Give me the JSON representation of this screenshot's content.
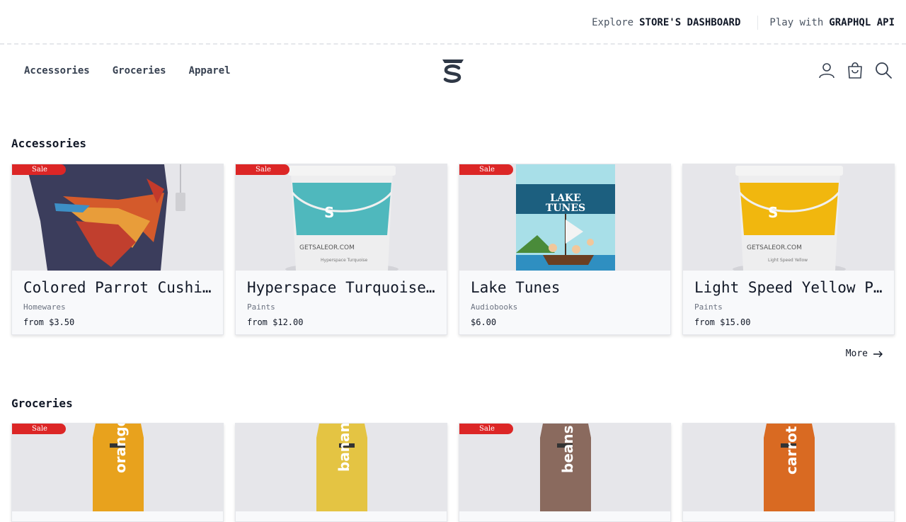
{
  "topbar": {
    "explore_prefix": "Explore",
    "explore_link": "STORE'S DASHBOARD",
    "play_prefix": "Play with",
    "play_link": "GRAPHQL API"
  },
  "nav": {
    "items": [
      "Accessories",
      "Groceries",
      "Apparel"
    ],
    "icons": [
      "user-icon",
      "cart-icon",
      "search-icon"
    ]
  },
  "sections": [
    {
      "title": "Accessories",
      "products": [
        {
          "name": "Colored Parrot Cushion",
          "category": "Homewares",
          "price": "from $3.50",
          "sale": "Sale"
        },
        {
          "name": "Hyperspace Turquoise Paint",
          "category": "Paints",
          "price": "from $12.00",
          "sale": "Sale"
        },
        {
          "name": "Lake Tunes",
          "category": "Audiobooks",
          "price": "$6.00",
          "sale": "Sale"
        },
        {
          "name": "Light Speed Yellow Paint",
          "category": "Paints",
          "price": "from $15.00",
          "sale": ""
        }
      ],
      "more_label": "More"
    },
    {
      "title": "Groceries",
      "products": [
        {
          "label": "orange s",
          "sale": "Sale"
        },
        {
          "label": "banana s",
          "sale": ""
        },
        {
          "label": "beans",
          "sale": "Sale"
        },
        {
          "label": "carrot s",
          "sale": ""
        }
      ]
    }
  ],
  "colors": {
    "sale": "#dc2626",
    "turquoise": "#4fb8bd",
    "yellow": "#f1b70e",
    "orange_juice": "#e8a21d",
    "banana_juice": "#e4c443",
    "bean_juice": "#8a6a5e",
    "carrot_juice": "#d96a22"
  },
  "book": {
    "title_line1": "LAKE",
    "title_line2": "TUNES"
  },
  "bucket_brand": "GETSALEOR.COM"
}
